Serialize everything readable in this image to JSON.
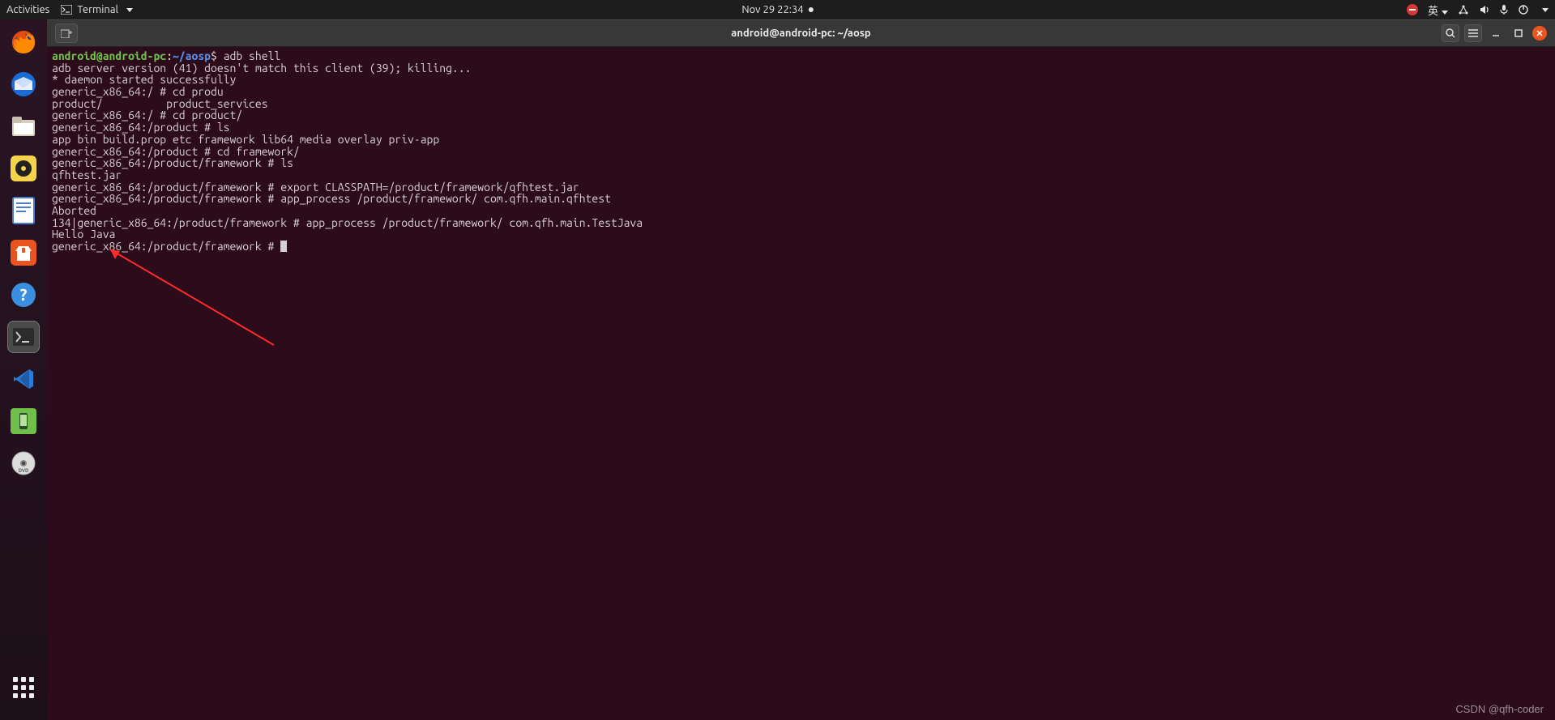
{
  "topbar": {
    "activities": "Activities",
    "app_name": "Terminal",
    "datetime": "Nov 29  22:34",
    "lang": "英"
  },
  "dock": {
    "items": [
      {
        "name": "firefox"
      },
      {
        "name": "thunderbird"
      },
      {
        "name": "files"
      },
      {
        "name": "rhythmbox"
      },
      {
        "name": "libreoffice-writer"
      },
      {
        "name": "ubuntu-software"
      },
      {
        "name": "help"
      },
      {
        "name": "terminal"
      },
      {
        "name": "vscode"
      },
      {
        "name": "android-studio"
      },
      {
        "name": "dvd"
      }
    ]
  },
  "window": {
    "title": "android@android-pc: ~/aosp"
  },
  "terminal": {
    "prompt_user": "android@android-pc",
    "prompt_sep": ":",
    "prompt_path": "~/aosp",
    "prompt_dollar": "$",
    "lines": [
      " adb shell",
      "adb server version (41) doesn't match this client (39); killing...",
      "* daemon started successfully",
      "generic_x86_64:/ # cd produ",
      "product/          product_services",
      "generic_x86_64:/ # cd product/",
      "generic_x86_64:/product # ls",
      "app bin build.prop etc framework lib64 media overlay priv-app",
      "generic_x86_64:/product # cd framework/",
      "generic_x86_64:/product/framework # ls",
      "qfhtest.jar",
      "generic_x86_64:/product/framework # export CLASSPATH=/product/framework/qfhtest.jar",
      "generic_x86_64:/product/framework # app_process /product/framework/ com.qfh.main.qfhtest",
      "Aborted",
      "134|generic_x86_64:/product/framework # app_process /product/framework/ com.qfh.main.TestJava",
      "Hello Java",
      "generic_x86_64:/product/framework # "
    ]
  },
  "watermark": "CSDN @qfh-coder"
}
